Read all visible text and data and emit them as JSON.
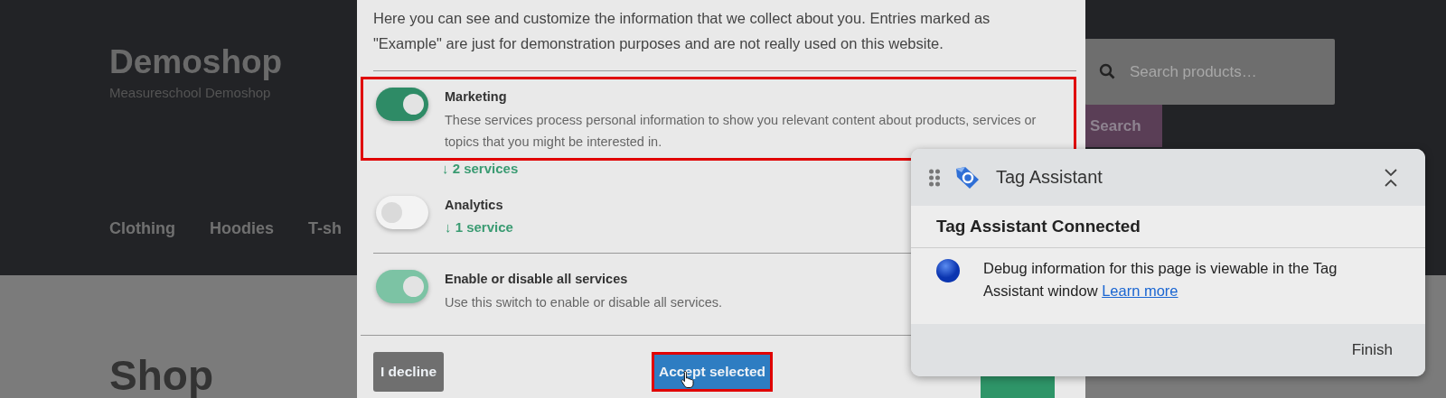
{
  "shop": {
    "title": "Demoshop",
    "subtitle": "Measureschool Demoshop",
    "nav": [
      "Clothing",
      "Hoodies",
      "T-sh"
    ],
    "search": {
      "placeholder": "Search products…",
      "button": "Search"
    },
    "heading": "Shop"
  },
  "consent": {
    "intro": "Here you can see and customize the information that we collect about you. Entries marked as \"Example\" are just for demonstration purposes and are not really used on this website.",
    "purposes": [
      {
        "title": "Marketing",
        "description": "These services process personal information to show you relevant content about products, services or topics that you might be interested in.",
        "services": "↓ 2 services",
        "on": true,
        "highlighted": true
      },
      {
        "title": "Analytics",
        "services": "↓ 1 service",
        "on": false
      }
    ],
    "all": {
      "title": "Enable or disable all services",
      "description": "Use this switch to enable or disable all services.",
      "on": true
    },
    "buttons": [
      {
        "kind": "decline",
        "label": "I decline"
      },
      {
        "kind": "selected",
        "label": "Accept selected",
        "highlighted": true
      },
      {
        "kind": "accept_all"
      }
    ]
  },
  "tag_assistant": {
    "title": "Tag Assistant",
    "status": "Tag Assistant Connected",
    "message": "Debug information for this page is viewable in the Tag Assistant window",
    "link": "Learn more",
    "button": "Finish"
  }
}
